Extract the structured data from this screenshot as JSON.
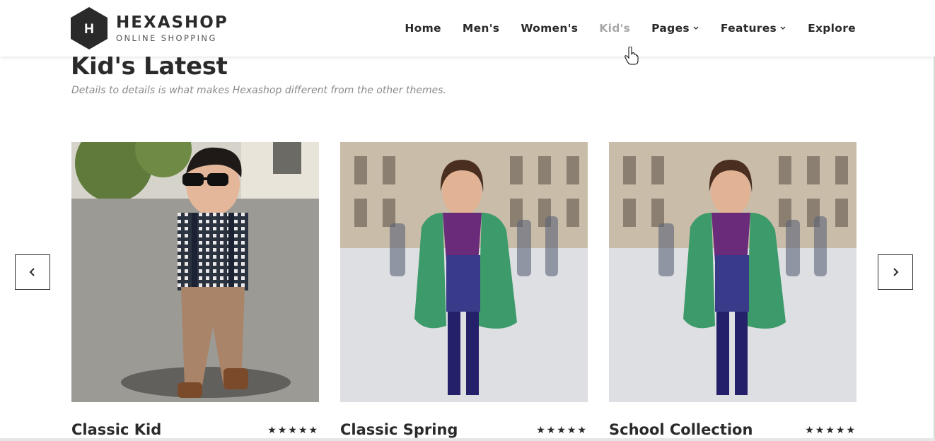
{
  "brand": {
    "logo_letter": "H",
    "name": "HEXASHOP",
    "tagline": "ONLINE SHOPPING"
  },
  "nav": {
    "items": [
      {
        "label": "Home",
        "icon": ""
      },
      {
        "label": "Men's",
        "icon": ""
      },
      {
        "label": "Women's",
        "icon": ""
      },
      {
        "label": "Kid's",
        "icon": "",
        "active": true
      },
      {
        "label": "Pages",
        "icon": "chevron-down-icon"
      },
      {
        "label": "Features",
        "icon": "chevron-down-icon"
      },
      {
        "label": "Explore",
        "icon": ""
      }
    ]
  },
  "section": {
    "title": "Kid's Latest",
    "subtitle": "Details to details is what makes Hexashop different from the other themes."
  },
  "products": [
    {
      "name": "Classic Kid",
      "rating": "★★★★★",
      "image": "boy-in-sunglasses-photo"
    },
    {
      "name": "Classic Spring",
      "rating": "★★★★★",
      "image": "girl-in-green-coat-photo"
    },
    {
      "name": "School Collection",
      "rating": "★★★★★",
      "image": "girl-in-green-coat-photo"
    }
  ],
  "controls": {
    "prev_icon": "chevron-left-icon",
    "next_icon": "chevron-right-icon"
  },
  "colors": {
    "text": "#2a2a2a",
    "nav_active": "#a8a8a8",
    "subtitle": "#8a8a8a"
  }
}
